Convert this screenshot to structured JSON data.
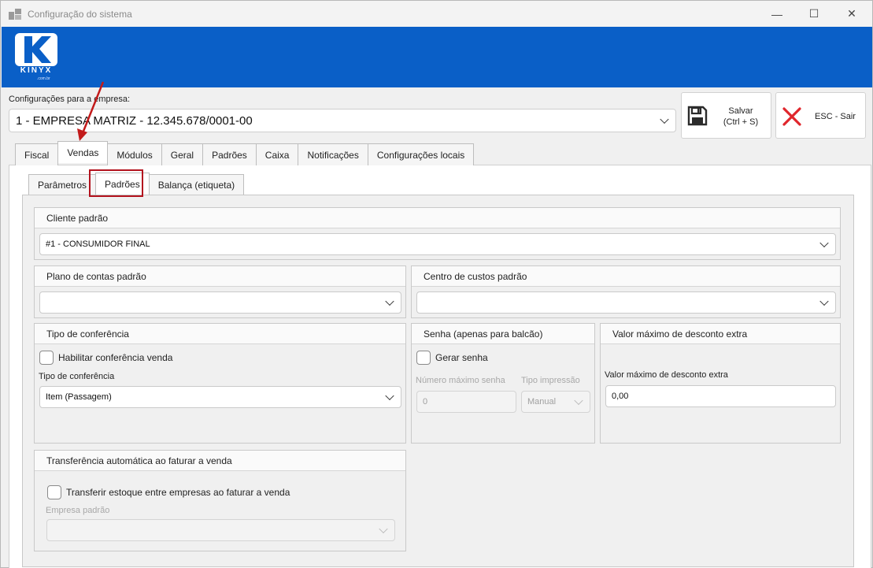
{
  "window": {
    "title": "Configuração do sistema",
    "controls": {
      "minimize": "—",
      "maximize": "☐",
      "close": "✕"
    }
  },
  "brand": {
    "name": "KINYX",
    "sub": ".com.br",
    "color": "#0a5fc7"
  },
  "company": {
    "label": "Configurações para a empresa:",
    "selected": "1 - EMPRESA MATRIZ - 12.345.678/0001-00"
  },
  "toolbar": {
    "save_label": "Salvar",
    "save_shortcut": "(Ctrl + S)",
    "exit_label": "ESC - Sair",
    "exit_color": "#e0262c"
  },
  "main_tabs": [
    "Fiscal",
    "Vendas",
    "Módulos",
    "Geral",
    "Padrões",
    "Caixa",
    "Notificações",
    "Configurações locais"
  ],
  "sub_tabs": [
    "Parâmetros",
    "Padrões",
    "Balança (etiqueta)"
  ],
  "highlight_color": "#b3131e",
  "cliente": {
    "title": "Cliente padrão",
    "value": "#1 - CONSUMIDOR FINAL"
  },
  "plano": {
    "title": "Plano de contas padrão",
    "value": ""
  },
  "centro": {
    "title": "Centro de custos padrão",
    "value": ""
  },
  "conferencia": {
    "title": "Tipo de conferência",
    "checkbox": "Habilitar conferência venda",
    "field_label": "Tipo de conferência",
    "value": "Item (Passagem)"
  },
  "senha": {
    "title": "Senha (apenas para balcão)",
    "checkbox": "Gerar senha",
    "max_label": "Número máximo senha",
    "max_value": "0",
    "tipo_label": "Tipo impressão",
    "tipo_value": "Manual"
  },
  "desconto": {
    "title": "Valor máximo de desconto extra",
    "field_label": "Valor máximo de desconto extra",
    "value": "0,00"
  },
  "transferencia": {
    "title": "Transferência automática ao faturar a venda",
    "checkbox": "Transferir estoque entre empresas ao faturar a venda",
    "empresa_label": "Empresa padrão",
    "empresa_value": ""
  }
}
